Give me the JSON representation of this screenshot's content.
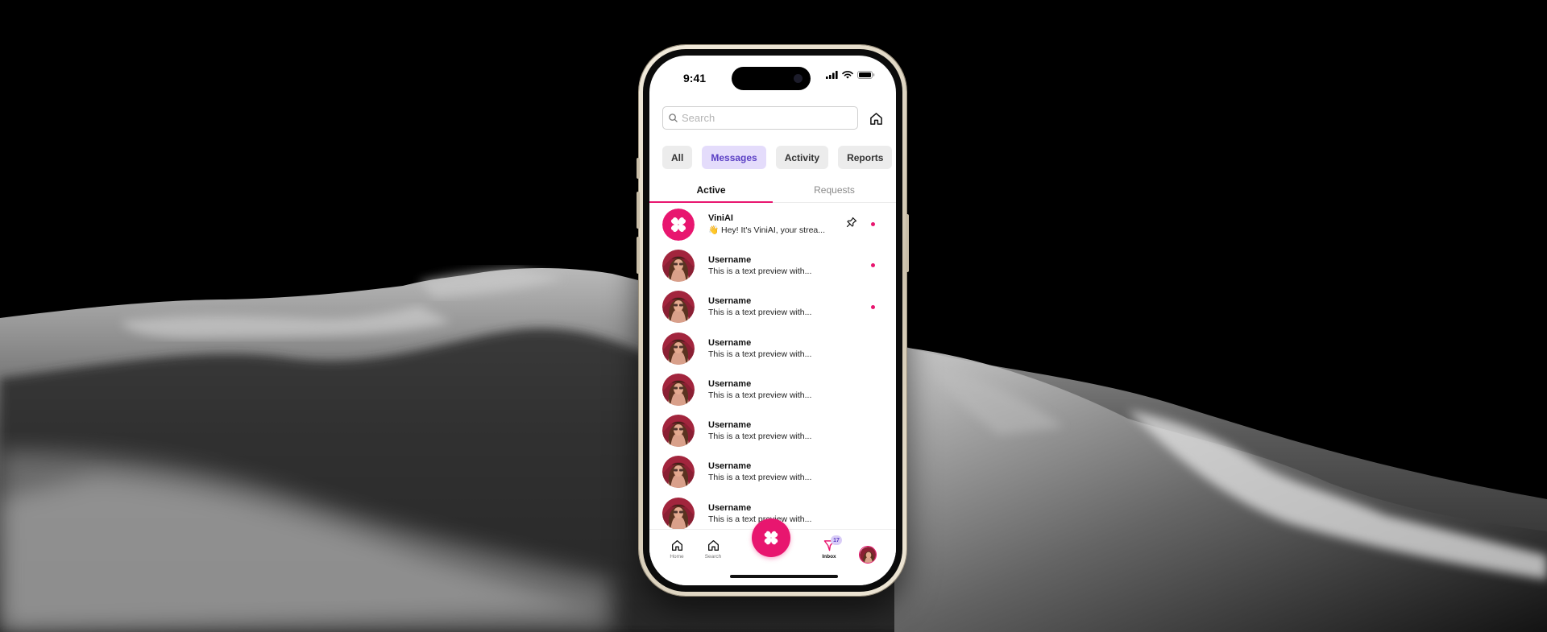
{
  "status_bar": {
    "time": "9:41"
  },
  "search": {
    "placeholder": "Search"
  },
  "filters": [
    "All",
    "Messages",
    "Activity",
    "Reports"
  ],
  "active_filter": "Messages",
  "tabs": {
    "active": "Active",
    "requests": "Requests"
  },
  "chats": [
    {
      "name": "ViniAI",
      "preview": "👋 Hey! It's ViniAI, your strea...",
      "avatar": "clover-logo",
      "pinned": true,
      "unread": true
    },
    {
      "name": "Username",
      "preview": "This is a text preview with...",
      "avatar": "user-photo",
      "pinned": false,
      "unread": true
    },
    {
      "name": "Username",
      "preview": "This is a text preview with...",
      "avatar": "user-photo",
      "pinned": false,
      "unread": true
    },
    {
      "name": "Username",
      "preview": "This is a text preview with...",
      "avatar": "user-photo",
      "pinned": false,
      "unread": false
    },
    {
      "name": "Username",
      "preview": "This is a text preview with...",
      "avatar": "user-photo",
      "pinned": false,
      "unread": false
    },
    {
      "name": "Username",
      "preview": "This is a text preview with...",
      "avatar": "user-photo",
      "pinned": false,
      "unread": false
    },
    {
      "name": "Username",
      "preview": "This is a text preview with...",
      "avatar": "user-photo",
      "pinned": false,
      "unread": false
    },
    {
      "name": "Username",
      "preview": "This is a text preview with...",
      "avatar": "user-photo",
      "pinned": false,
      "unread": false
    }
  ],
  "bottom_nav": {
    "home": "Home",
    "search": "Search",
    "inbox": "Inbox",
    "inbox_badge": "17"
  },
  "colors": {
    "accent": "#e8166f",
    "chip_active_bg": "#e4dcfb",
    "chip_active_text": "#5a3fc4"
  },
  "icons": {
    "search": "search-icon",
    "home": "home-icon",
    "pin": "pin-icon",
    "inbox": "inbox-icon",
    "clover": "clover-icon"
  }
}
